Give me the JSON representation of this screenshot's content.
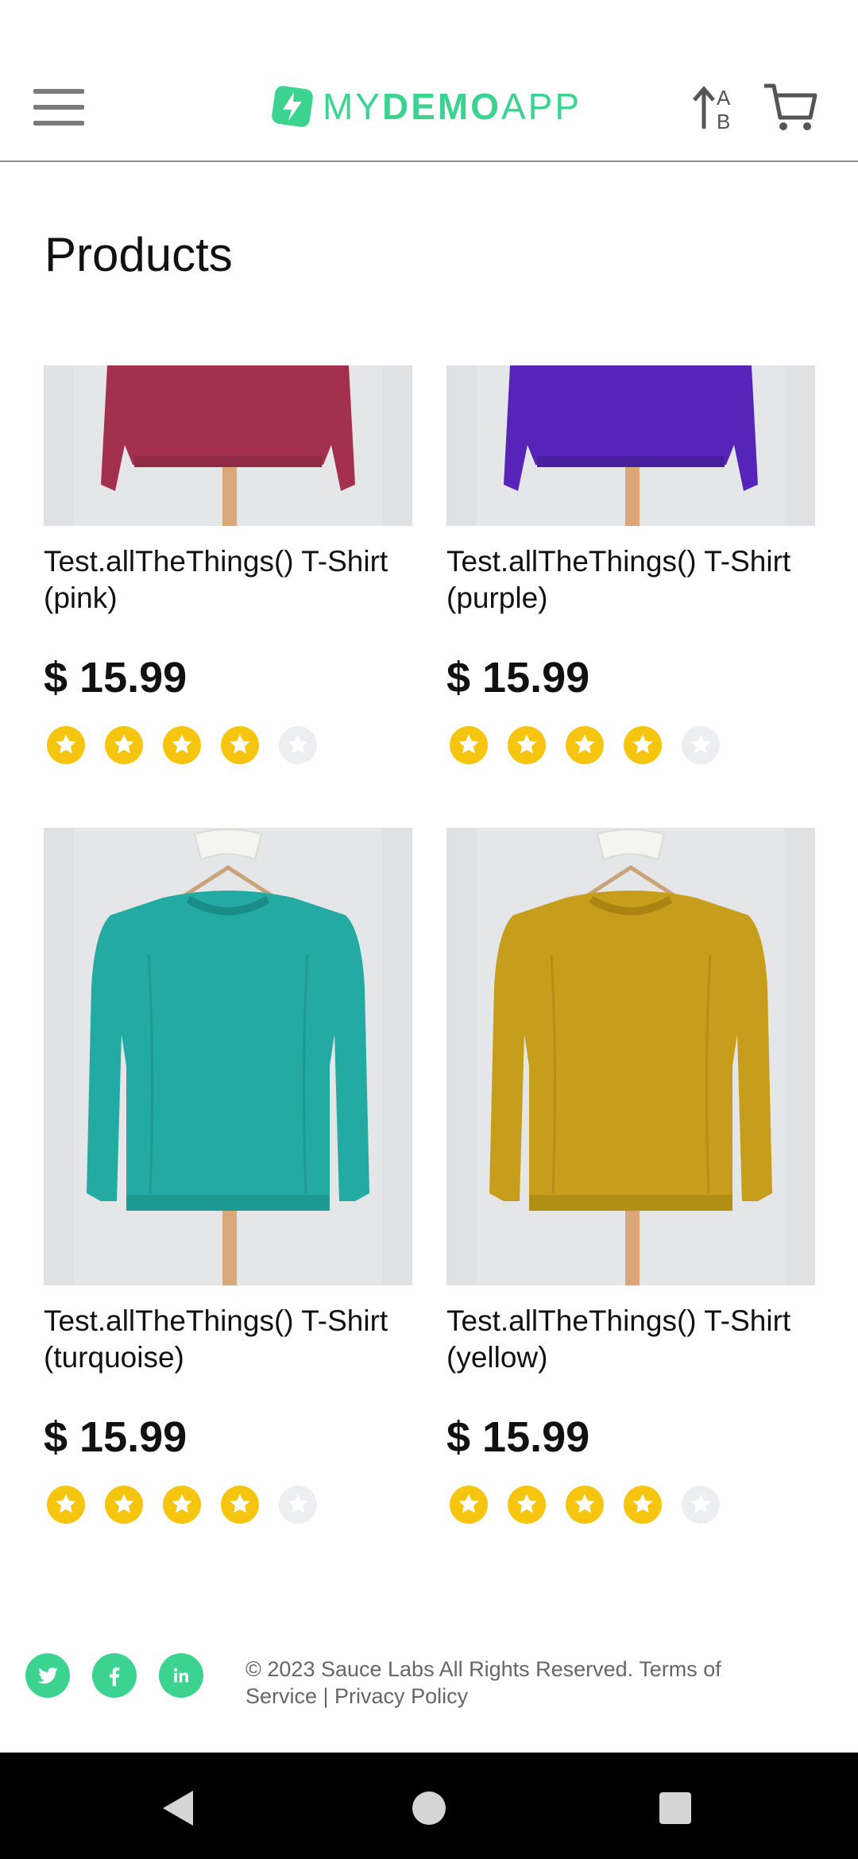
{
  "header": {
    "logo_text_thin": "MY",
    "logo_text_bold": "DEMO",
    "logo_text_end": "APP",
    "icons": [
      "menu-icon",
      "logo-icon",
      "sort-icon",
      "cart-icon"
    ]
  },
  "page_title": "Products",
  "products": [
    {
      "name": "Test.allTheThings() T-Shirt (pink)",
      "price": "$ 15.99",
      "rating": 4,
      "max_rating": 5,
      "color": "#a3314e"
    },
    {
      "name": "Test.allTheThings() T-Shirt (purple)",
      "price": "$ 15.99",
      "rating": 4,
      "max_rating": 5,
      "color": "#5624b8"
    },
    {
      "name": "Test.allTheThings() T-Shirt (turquoise)",
      "price": "$ 15.99",
      "rating": 4,
      "max_rating": 5,
      "color": "#23aaa3"
    },
    {
      "name": "Test.allTheThings() T-Shirt (yellow)",
      "price": "$ 15.99",
      "rating": 4,
      "max_rating": 5,
      "color": "#c79e1b"
    }
  ],
  "footer": {
    "social": [
      "twitter-icon",
      "facebook-icon",
      "linkedin-icon"
    ],
    "text": "© 2023 Sauce Labs All Rights Reserved. Terms of Service | Privacy Policy"
  },
  "colors": {
    "accent": "#3cd390",
    "star": "#f6c50f",
    "star_empty": "#eceef1"
  }
}
